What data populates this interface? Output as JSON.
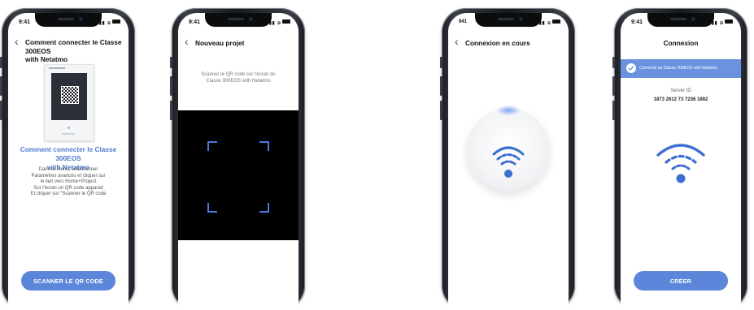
{
  "colors": {
    "accent": "#5b86d9",
    "accent_text": "#4f7ccf",
    "banner": "#6a92df",
    "wifi": "#3d6fd1",
    "scanner_bg": "#000000"
  },
  "status_bar": {
    "time": "9:41",
    "time_short": "941"
  },
  "screen1": {
    "title_line1": "Comment connecter le Classe 300EOS",
    "title_line2": "with Netatmo",
    "heading_line1": "Comment connecter le Classe 300EOS",
    "heading_line2": "with Netatmo",
    "instructions": [
      "Dans le menu, sélectionner",
      "Paramètres avancés et cliquer sur",
      "le lien vers Home+Project",
      "Sur l'écran un QR code apparait",
      "Et cliquer sur \"Scanner le QR code"
    ],
    "button_label": "SCANNER LE QR CODE"
  },
  "screen2": {
    "title": "Nouveau projet",
    "hint_line1": "Scanner le QR code sur l'écran du",
    "hint_line2": "Classe 300EOS with Netatmo"
  },
  "screen3": {
    "title": "Connexion en cours"
  },
  "screen4": {
    "title": "Connexion",
    "banner_text": "Connecté au Classe 300EOS with Netatmo",
    "server_label": "Server ID",
    "server_id": "1873 2612 73 7236 1892",
    "button_label": "CRÉER"
  },
  "icons": [
    "back-chevron-icon",
    "signal-icon",
    "wifi-status-icon",
    "battery-icon",
    "qr-code-icon",
    "checkmark-icon",
    "wifi-icon"
  ]
}
